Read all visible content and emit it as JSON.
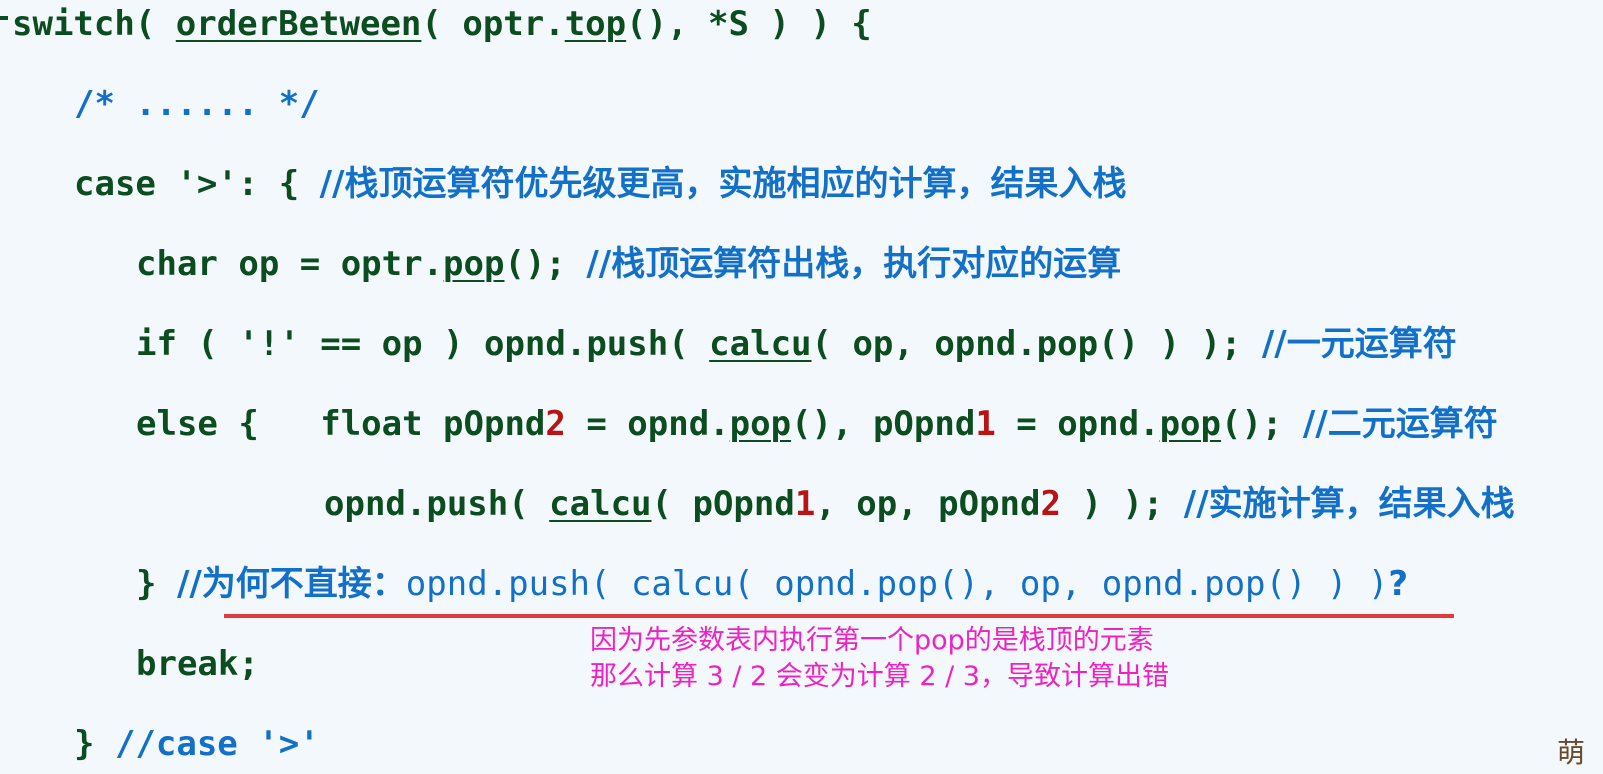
{
  "code": {
    "l1": {
      "a": "switch( ",
      "fn1": "orderBetween",
      "b": "( optr.",
      "fn2": "top",
      "c": "(), *S ) ) {"
    },
    "l2": {
      "text": "/* ...... */"
    },
    "l3": {
      "code": "case '>': { ",
      "comment": "//栈顶运算符优先级更高，实施相应的计算，结果入栈"
    },
    "l4": {
      "a": "char op = optr.",
      "fn": "pop",
      "b": "(); ",
      "comment": "//栈顶运算符出栈，执行对应的运算"
    },
    "l5": {
      "a": "if ( '!' == op ) opnd.push( ",
      "fn": "calcu",
      "b": "( op, opnd.pop() ) ); ",
      "comment": "//一元运算符"
    },
    "l6": {
      "a": "else {   float pOpnd",
      "n1": "2",
      "b": " = opnd.",
      "fn1": "pop",
      "c": "(), pOpnd",
      "n2": "1",
      "d": " = opnd.",
      "fn2": "pop",
      "e": "(); ",
      "comment": "//二元运算符"
    },
    "l7": {
      "a": "opnd.push( ",
      "fn": "calcu",
      "b": "( pOpnd",
      "n1": "1",
      "c": ", op, pOpnd",
      "n2": "2",
      "d": " ) ); ",
      "comment": "//实施计算，结果入栈"
    },
    "l8": {
      "a": "} ",
      "comment_cn": "//为何不直接：",
      "comment_code": "opnd.push( calcu( opnd.pop(), op, opnd.pop() ) )",
      "q": "?"
    },
    "l9": {
      "text": "break;"
    },
    "l10": {
      "a": "} ",
      "comment": "//case '>'"
    }
  },
  "note": {
    "line1": "因为先参数表内执行第一个pop的是栈顶的元素",
    "line2": "那么计算 3 / 2 会变为计算 2 / 3，导致计算出错"
  },
  "corner_text": "萌"
}
